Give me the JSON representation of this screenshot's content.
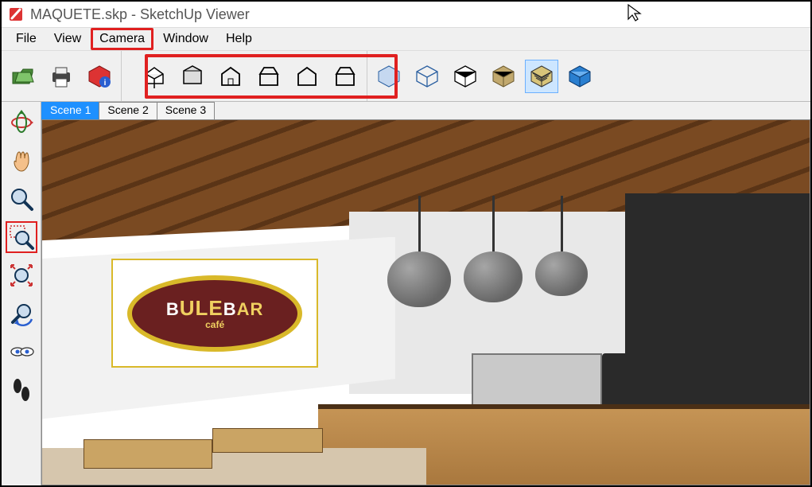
{
  "window": {
    "title": "MAQUETE.skp - SketchUp Viewer"
  },
  "menubar": {
    "items": [
      "File",
      "View",
      "Camera",
      "Window",
      "Help"
    ],
    "highlighted_index": 2
  },
  "toolbar": {
    "file_group": [
      {
        "name": "open-icon"
      },
      {
        "name": "print-icon"
      },
      {
        "name": "model-info-icon"
      }
    ],
    "views_group": [
      {
        "name": "iso-view-icon"
      },
      {
        "name": "top-view-icon"
      },
      {
        "name": "front-view-icon"
      },
      {
        "name": "right-view-icon"
      },
      {
        "name": "back-view-icon"
      },
      {
        "name": "left-view-icon"
      }
    ],
    "styles_group": [
      {
        "name": "xray-icon"
      },
      {
        "name": "wireframe-icon"
      },
      {
        "name": "hiddenline-icon"
      },
      {
        "name": "shaded-icon"
      },
      {
        "name": "shaded-textures-icon",
        "selected": true
      },
      {
        "name": "monochrome-icon"
      }
    ],
    "views_highlighted": true
  },
  "side_toolbar": {
    "items": [
      {
        "name": "orbit-icon"
      },
      {
        "name": "pan-icon"
      },
      {
        "name": "zoom-icon"
      },
      {
        "name": "zoom-window-icon",
        "active": true
      },
      {
        "name": "zoom-extents-icon"
      },
      {
        "name": "previous-view-icon"
      },
      {
        "name": "look-around-icon"
      },
      {
        "name": "walk-icon"
      }
    ]
  },
  "scene_tabs": {
    "tabs": [
      "Scene 1",
      "Scene 2",
      "Scene 3"
    ],
    "active_index": 0
  },
  "viewport": {
    "logo_main": "BULEBAR",
    "logo_sub": "café"
  },
  "colors": {
    "highlight": "#e02020",
    "tab_active": "#1e90ff"
  }
}
